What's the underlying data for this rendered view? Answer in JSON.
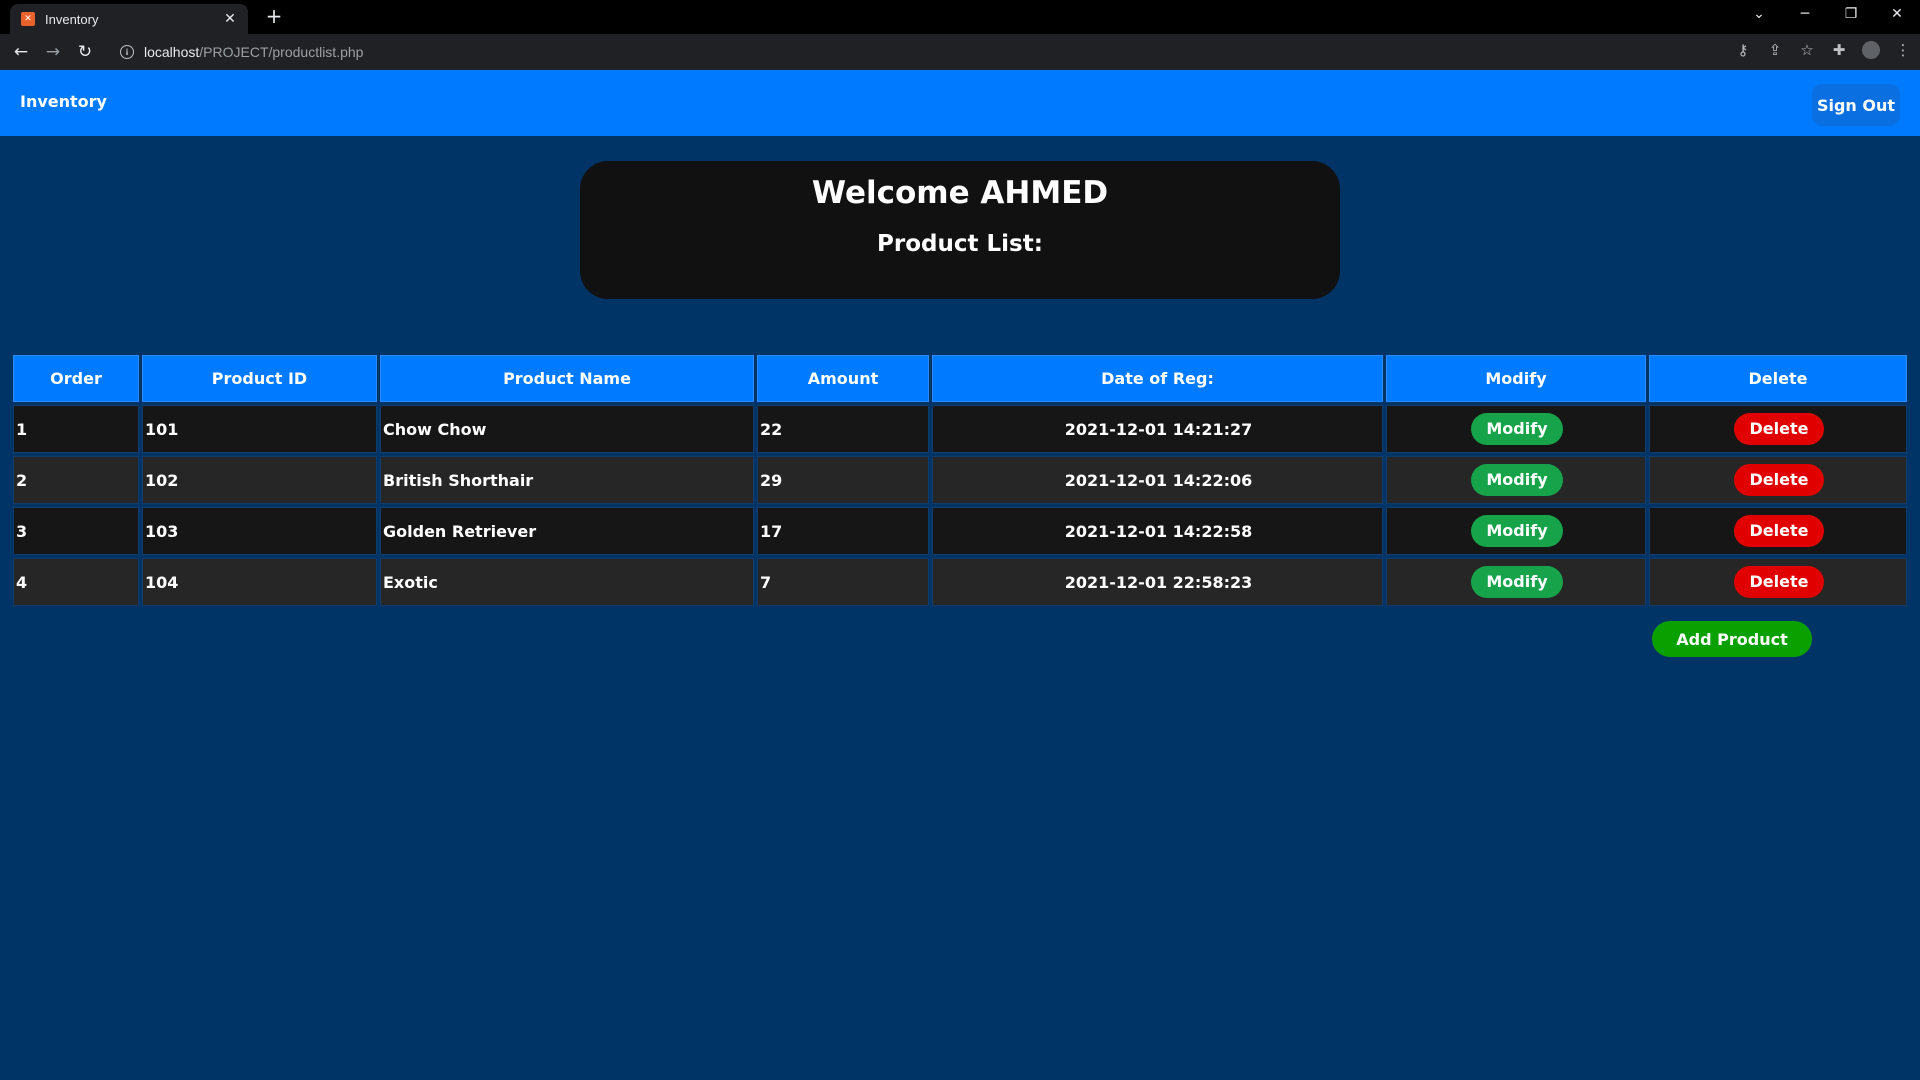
{
  "browser": {
    "tab_title": "Inventory",
    "tab_favicon": "xampp-icon",
    "url_host": "localhost",
    "url_path": "/PROJECT/productlist.php"
  },
  "navbar": {
    "brand": "Inventory",
    "signout_label": "Sign Out",
    "color": "#007bff"
  },
  "welcome": {
    "title": "Welcome AHMED",
    "subtitle": "Product List:"
  },
  "table": {
    "headers": [
      "Order",
      "Product ID",
      "Product Name",
      "Amount",
      "Date of Reg:",
      "Modify",
      "Delete"
    ],
    "rows": [
      {
        "order": "1",
        "id": "101",
        "name": "Chow Chow",
        "amount": "22",
        "date": "2021-12-01 14:21:27",
        "modify": "Modify",
        "delete": "Delete"
      },
      {
        "order": "2",
        "id": "102",
        "name": "British Shorthair",
        "amount": "29",
        "date": "2021-12-01 14:22:06",
        "modify": "Modify",
        "delete": "Delete"
      },
      {
        "order": "3",
        "id": "103",
        "name": "Golden Retriever",
        "amount": "17",
        "date": "2021-12-01 14:22:58",
        "modify": "Modify",
        "delete": "Delete"
      },
      {
        "order": "4",
        "id": "104",
        "name": "Exotic",
        "amount": "7",
        "date": "2021-12-01 22:58:23",
        "modify": "Modify",
        "delete": "Delete"
      }
    ]
  },
  "add_product_label": "Add Product",
  "colors": {
    "page_bg": "#003366",
    "modify_button": "#16a34a",
    "delete_button": "#e00000",
    "add_button": "#0aa100"
  }
}
